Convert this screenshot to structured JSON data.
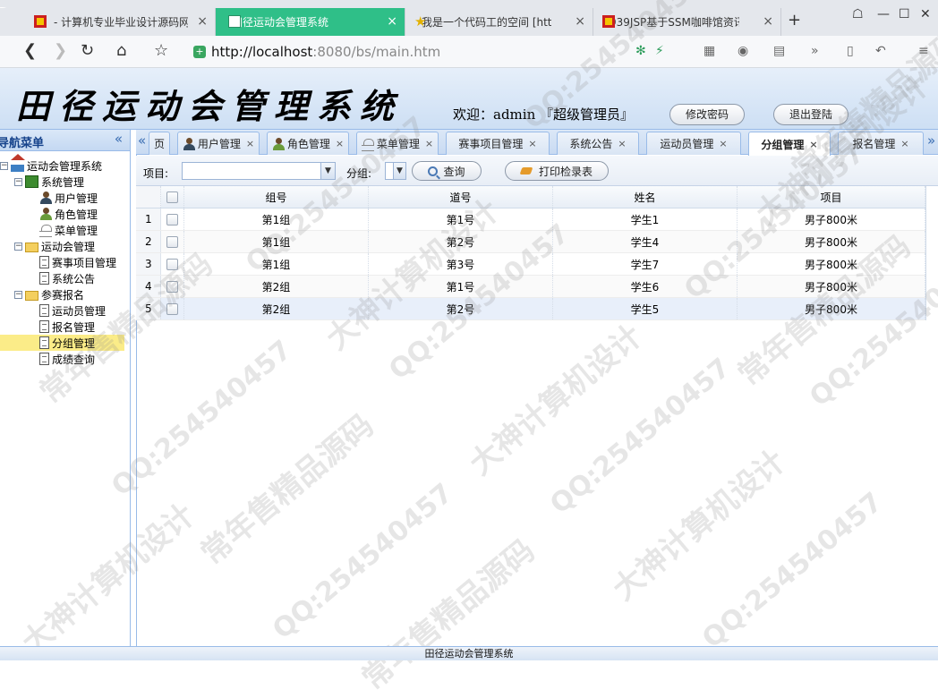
{
  "browser": {
    "tabs": [
      {
        "label": "- 计算机专业毕业设计源码网",
        "active": false,
        "favicon": "red-flag-favicon"
      },
      {
        "label": "田径运动会管理系统",
        "active": true,
        "favicon": "page-favicon"
      },
      {
        "label": "我是一个代码工的空间 [htt",
        "active": false,
        "favicon": "star-favicon"
      },
      {
        "label": "939JSP基于SSM咖啡馆资讯",
        "active": false,
        "favicon": "red-flag-favicon"
      }
    ],
    "new_tab": "+",
    "url_host": "http://localhost",
    "url_rest": ":8080/bs/main.htm"
  },
  "header": {
    "title": "田径运动会管理系统",
    "welcome": "欢迎：admin 『超级管理员』",
    "change_password": "修改密码",
    "logout": "退出登陆"
  },
  "nav": {
    "title": "导航菜单",
    "tree": [
      {
        "label": "运动会管理系统",
        "icon": "home-icon",
        "level": 0,
        "toggle": "−"
      },
      {
        "label": "系统管理",
        "icon": "grid-icon",
        "level": 1,
        "toggle": "−"
      },
      {
        "label": "用户管理",
        "icon": "user-icon",
        "level": 2
      },
      {
        "label": "角色管理",
        "icon": "role-icon",
        "level": 2
      },
      {
        "label": "菜单管理",
        "icon": "menu-icon",
        "level": 2
      },
      {
        "label": "运动会管理",
        "icon": "folder-icon",
        "level": 1,
        "toggle": "−"
      },
      {
        "label": "赛事项目管理",
        "icon": "page-icon",
        "level": 2
      },
      {
        "label": "系统公告",
        "icon": "page-icon",
        "level": 2
      },
      {
        "label": "参赛报名",
        "icon": "folder-icon",
        "level": 1,
        "toggle": "−"
      },
      {
        "label": "运动员管理",
        "icon": "page-icon",
        "level": 2
      },
      {
        "label": "报名管理",
        "icon": "page-icon",
        "level": 2
      },
      {
        "label": "分组管理",
        "icon": "page-icon",
        "level": 2,
        "selected": true
      },
      {
        "label": "成绩查询",
        "icon": "page-icon",
        "level": 2
      }
    ]
  },
  "content_tabs": [
    {
      "label": "页",
      "closable": false
    },
    {
      "label": "用户管理",
      "closable": true,
      "icon": "user-icon"
    },
    {
      "label": "角色管理",
      "closable": true,
      "icon": "role-icon"
    },
    {
      "label": "菜单管理",
      "closable": true,
      "icon": "menu-icon"
    },
    {
      "label": "赛事项目管理",
      "closable": true
    },
    {
      "label": "系统公告",
      "closable": true
    },
    {
      "label": "运动员管理",
      "closable": true
    },
    {
      "label": "分组管理",
      "closable": true,
      "active": true
    },
    {
      "label": "报名管理",
      "closable": true
    }
  ],
  "toolbar": {
    "project_label": "项目:",
    "project_value": "",
    "group_label": "分组:",
    "group_value": "",
    "search": "查询",
    "print": "打印检录表"
  },
  "grid": {
    "columns": [
      "组号",
      "道号",
      "姓名",
      "项目"
    ],
    "rows": [
      {
        "num": "1",
        "group": "第1组",
        "lane": "第1号",
        "name": "学生1",
        "event": "男子800米"
      },
      {
        "num": "2",
        "group": "第1组",
        "lane": "第2号",
        "name": "学生4",
        "event": "男子800米"
      },
      {
        "num": "3",
        "group": "第1组",
        "lane": "第3号",
        "name": "学生7",
        "event": "男子800米"
      },
      {
        "num": "4",
        "group": "第2组",
        "lane": "第1号",
        "name": "学生6",
        "event": "男子800米"
      },
      {
        "num": "5",
        "group": "第2组",
        "lane": "第2号",
        "name": "学生5",
        "event": "男子800米"
      }
    ]
  },
  "footer": "田径运动会管理系统",
  "watermarks": {
    "qq": "QQ:25454045​7",
    "design": "大神计算机设计",
    "source": "常年售精品源码"
  }
}
